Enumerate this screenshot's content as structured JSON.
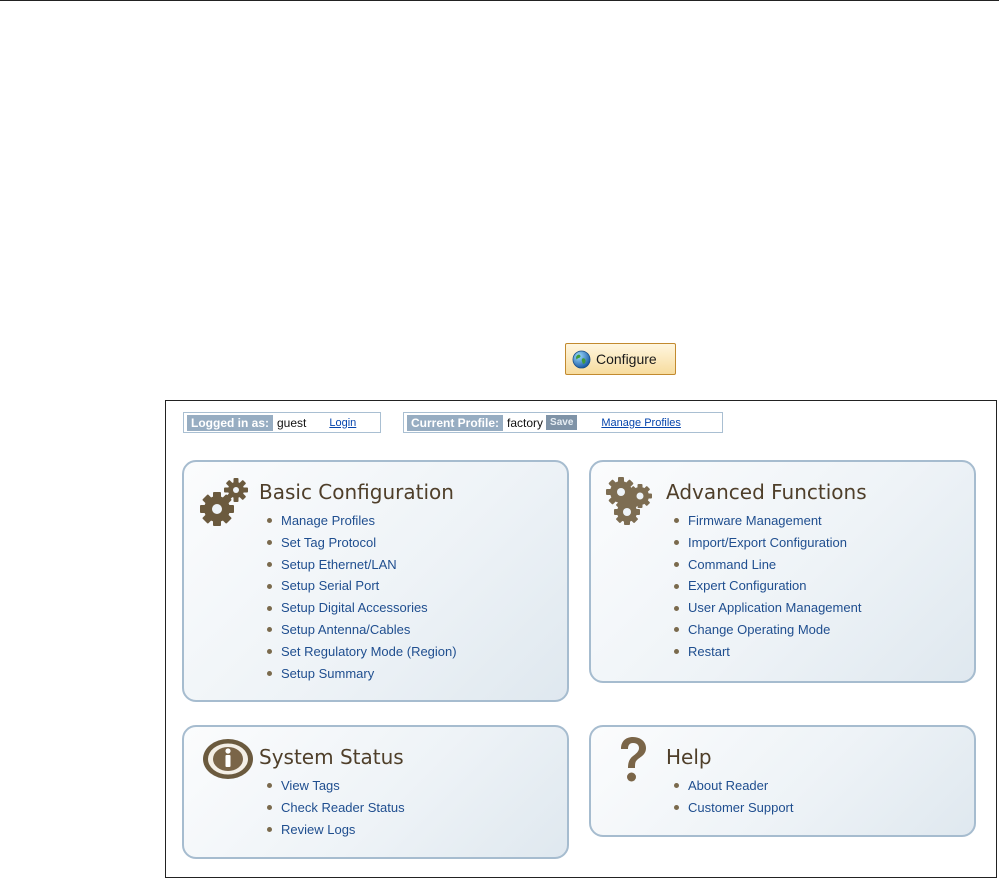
{
  "configure_button": {
    "label": "Configure",
    "icon": "globe-icon"
  },
  "status_bar": {
    "logged_in_label": "Logged in as:",
    "user": "guest",
    "login_link": "Login",
    "profile_label": "Current Profile:",
    "profile": "factory",
    "save_label": "Save",
    "manage_profiles_link": "Manage Profiles"
  },
  "sections": {
    "basic": {
      "title": "Basic Configuration",
      "icon": "gears-icon",
      "items": [
        "Manage Profiles",
        "Set Tag Protocol",
        "Setup Ethernet/LAN",
        "Setup Serial Port",
        "Setup Digital Accessories",
        "Setup Antenna/Cables",
        "Set Regulatory Mode (Region)",
        "Setup Summary"
      ]
    },
    "advanced": {
      "title": "Advanced Functions",
      "icon": "cluster-gears-icon",
      "items": [
        "Firmware Management",
        "Import/Export Configuration",
        "Command Line",
        "Expert Configuration",
        "User Application Management",
        "Change Operating Mode",
        "Restart"
      ]
    },
    "status": {
      "title": "System Status",
      "icon": "info-icon",
      "items": [
        "View Tags",
        "Check Reader Status",
        "Review Logs"
      ]
    },
    "help": {
      "title": "Help",
      "icon": "question-mark-icon",
      "items": [
        "About Reader",
        "Customer Support"
      ]
    }
  },
  "colors": {
    "accent": "#a6bccf",
    "link": "#1f4e8f",
    "title": "#4f3f2a",
    "button_border": "#c28a2f"
  }
}
